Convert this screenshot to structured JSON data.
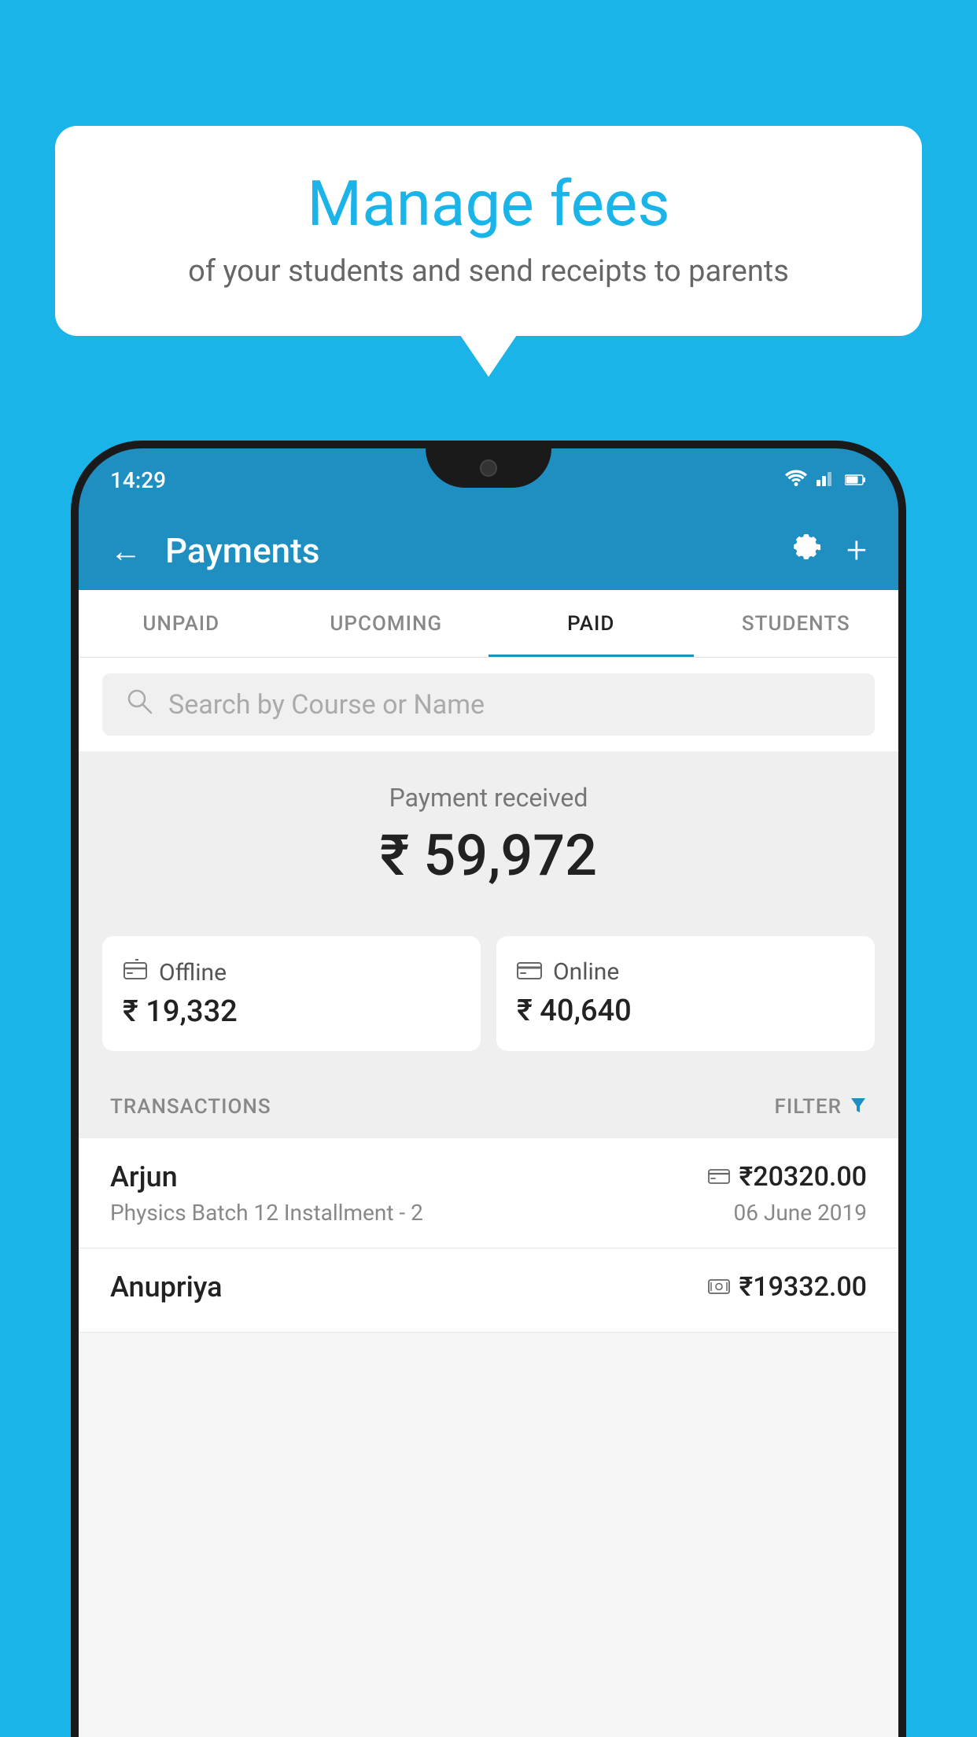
{
  "background_color": "#1ab4e8",
  "bubble": {
    "title": "Manage fees",
    "subtitle": "of your students and send receipts to parents"
  },
  "phone": {
    "status_bar": {
      "time": "14:29",
      "wifi_icon": "▼",
      "signal_icon": "▲",
      "battery_icon": "▮"
    },
    "header": {
      "back_icon": "←",
      "title": "Payments",
      "gear_icon": "⚙",
      "plus_icon": "+"
    },
    "tabs": [
      {
        "label": "UNPAID",
        "active": false
      },
      {
        "label": "UPCOMING",
        "active": false
      },
      {
        "label": "PAID",
        "active": true
      },
      {
        "label": "STUDENTS",
        "active": false
      }
    ],
    "search": {
      "placeholder": "Search by Course or Name"
    },
    "payment_received": {
      "label": "Payment received",
      "amount": "₹ 59,972"
    },
    "offline_card": {
      "icon": "💳",
      "label": "Offline",
      "amount": "₹ 19,332"
    },
    "online_card": {
      "icon": "💳",
      "label": "Online",
      "amount": "₹ 40,640"
    },
    "transactions_label": "TRANSACTIONS",
    "filter_label": "FILTER",
    "transactions": [
      {
        "name": "Arjun",
        "course": "Physics Batch 12 Installment - 2",
        "amount": "₹20320.00",
        "date": "06 June 2019",
        "icon": "card"
      },
      {
        "name": "Anupriya",
        "course": "",
        "amount": "₹19332.00",
        "date": "",
        "icon": "cash"
      }
    ]
  }
}
